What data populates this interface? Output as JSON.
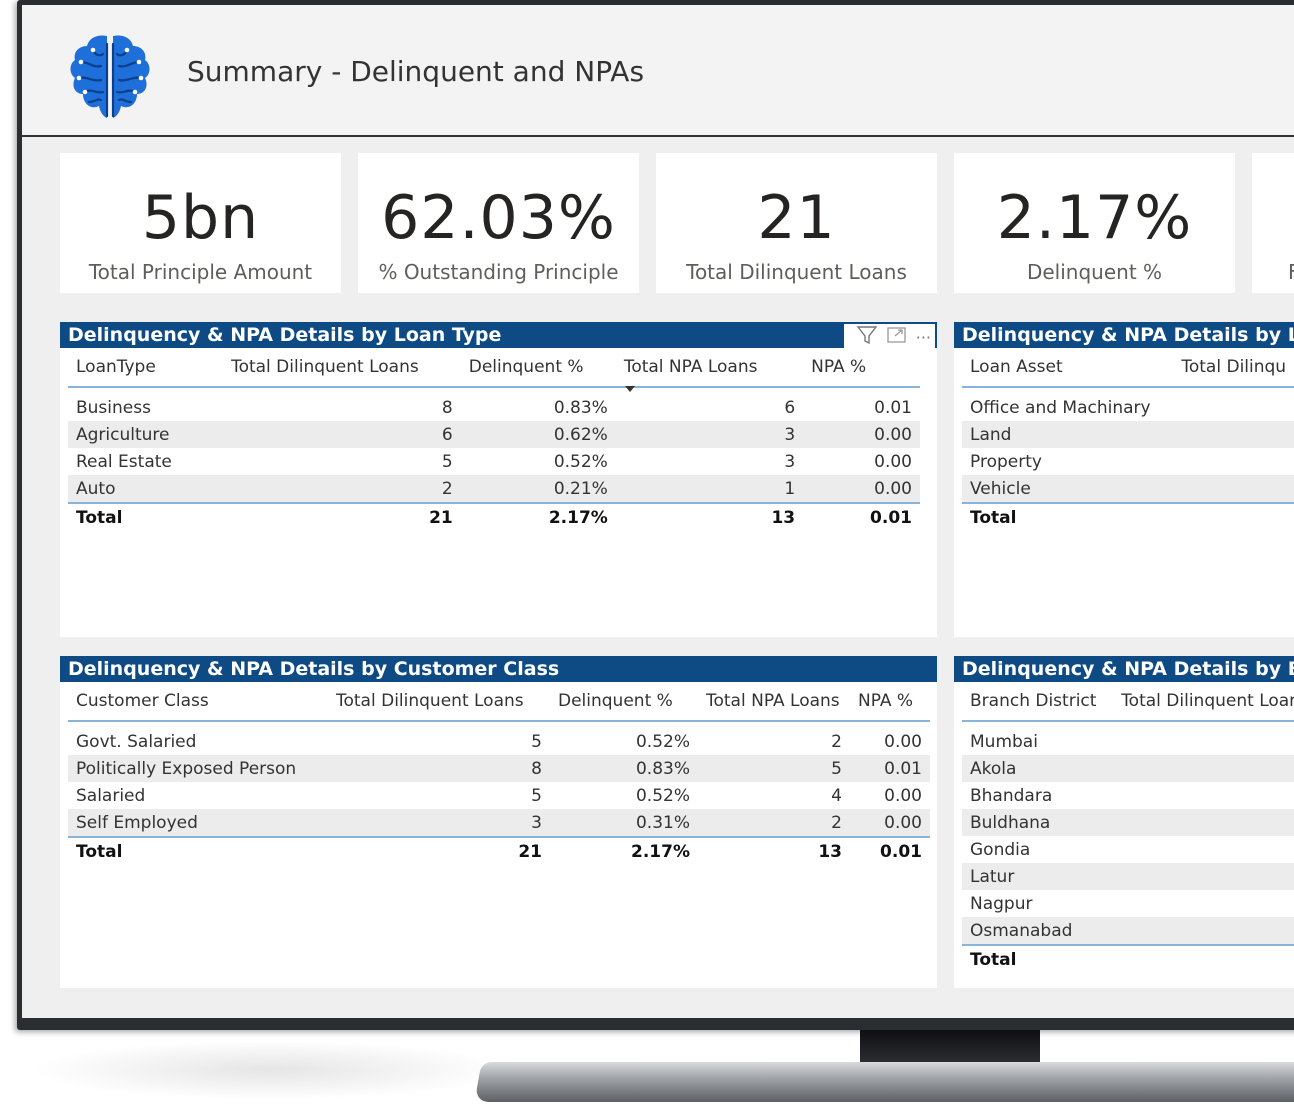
{
  "header": {
    "title": "Summary - Delinquent and NPAs",
    "logo_icon": "brain-icon",
    "logo_color": "#1e6fd9"
  },
  "kpis": [
    {
      "value": "5bn",
      "label": "Total Principle Amount"
    },
    {
      "value": "62.03%",
      "label": "% Outstanding Principle"
    },
    {
      "value": "21",
      "label": "Total Dilinquent Loans"
    },
    {
      "value": "2.17%",
      "label": "Delinquent %"
    },
    {
      "value": "",
      "label": "F"
    }
  ],
  "loan_type": {
    "title": "Delinquency & NPA Details by Loan Type",
    "columns": [
      "LoanType",
      "Total Dilinquent Loans",
      "Delinquent %",
      "Total NPA Loans",
      "NPA %"
    ],
    "rows": [
      [
        "Business",
        "8",
        "0.83%",
        "6",
        "0.01"
      ],
      [
        "Agriculture",
        "6",
        "0.62%",
        "3",
        "0.00"
      ],
      [
        "Real Estate",
        "5",
        "0.52%",
        "3",
        "0.00"
      ],
      [
        "Auto",
        "2",
        "0.21%",
        "1",
        "0.00"
      ]
    ],
    "total": [
      "Total",
      "21",
      "2.17%",
      "13",
      "0.01"
    ]
  },
  "loan_asset": {
    "title": "Delinquency & NPA Details by L",
    "columns": [
      "Loan Asset",
      "Total Dilinqu"
    ],
    "rows": [
      [
        "Office and Machinary"
      ],
      [
        "Land"
      ],
      [
        "Property"
      ],
      [
        "Vehicle"
      ]
    ],
    "total": [
      "Total"
    ]
  },
  "customer_class": {
    "title": "Delinquency & NPA Details by Customer Class",
    "columns": [
      "Customer Class",
      "Total Dilinquent Loans",
      "Delinquent %",
      "Total NPA Loans",
      "NPA %"
    ],
    "rows": [
      [
        "Govt. Salaried",
        "5",
        "0.52%",
        "2",
        "0.00"
      ],
      [
        "Politically Exposed Person",
        "8",
        "0.83%",
        "5",
        "0.01"
      ],
      [
        "Salaried",
        "5",
        "0.52%",
        "4",
        "0.00"
      ],
      [
        "Self Employed",
        "3",
        "0.31%",
        "2",
        "0.00"
      ]
    ],
    "total": [
      "Total",
      "21",
      "2.17%",
      "13",
      "0.01"
    ]
  },
  "branch": {
    "title": "Delinquency & NPA Details by B",
    "columns": [
      "Branch District",
      "Total Dilinquent Loar"
    ],
    "rows": [
      [
        "Mumbai"
      ],
      [
        "Akola"
      ],
      [
        "Bhandara"
      ],
      [
        "Buldhana"
      ],
      [
        "Gondia"
      ],
      [
        "Latur"
      ],
      [
        "Nagpur"
      ],
      [
        "Osmanabad"
      ]
    ],
    "total": [
      "Total"
    ]
  },
  "visual_header_icons": [
    "filter-icon",
    "focus-mode-icon",
    "more-options-icon"
  ]
}
